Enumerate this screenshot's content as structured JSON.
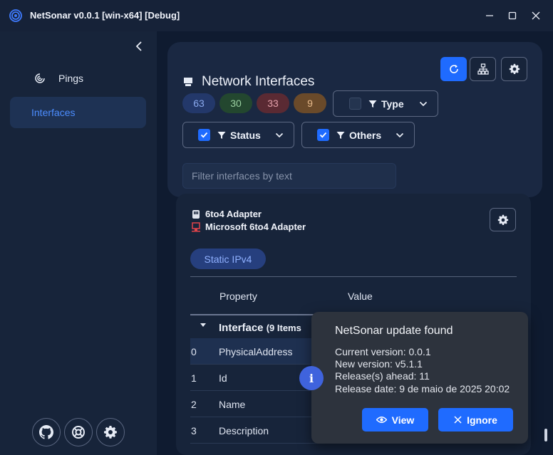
{
  "titlebar": {
    "title": "NetSonar v0.0.1   [win-x64] [Debug]",
    "minimize_icon": "minimize-icon",
    "maximize_icon": "maximize-icon",
    "close_icon": "close-icon"
  },
  "sidebar": {
    "collapse_icon": "chevron-left-icon",
    "items": [
      {
        "label": "Pings",
        "icon": "sonar-icon",
        "active": false
      },
      {
        "label": "Interfaces",
        "active": true
      }
    ],
    "footer_icons": [
      "github-icon",
      "support-icon",
      "gear-icon"
    ]
  },
  "panel": {
    "title": "Network Interfaces",
    "title_icon": "network-adapter-icon",
    "toolbar_icons": [
      "refresh-icon",
      "network-topology-icon",
      "gear-icon"
    ],
    "counts": [
      {
        "value": "63",
        "bg": "#23386a",
        "fg": "#8aa9ee"
      },
      {
        "value": "30",
        "bg": "#23472f",
        "fg": "#9ad0a0"
      },
      {
        "value": "33",
        "bg": "#5a2a33",
        "fg": "#e3a0aa"
      },
      {
        "value": "9",
        "bg": "#6a4a2a",
        "fg": "#e6b98a"
      }
    ],
    "filters": {
      "type": {
        "label": "Type",
        "checked": false
      },
      "status": {
        "label": "Status",
        "checked": true
      },
      "others": {
        "label": "Others",
        "checked": true
      }
    },
    "search": {
      "value": "",
      "placeholder": "Filter interfaces by text"
    }
  },
  "card": {
    "adapter_name": "6to4 Adapter",
    "adapter_description": "Microsoft 6to4 Adapter",
    "chip": "Static IPv4",
    "table": {
      "headers": [
        "Property",
        "Value"
      ],
      "group": {
        "name": "Interface",
        "count": "(9 Items"
      },
      "rows": [
        {
          "index": "0",
          "name": "PhysicalAddress",
          "selected": true
        },
        {
          "index": "1",
          "name": "Id",
          "selected": false
        },
        {
          "index": "2",
          "name": "Name",
          "selected": false
        },
        {
          "index": "3",
          "name": "Description",
          "selected": false
        }
      ]
    }
  },
  "toast": {
    "title": "NetSonar update found",
    "lines": [
      "Current version: 0.0.1",
      "New version: v5.1.1",
      "Release(s) ahead: 11",
      "Release date: 9 de maio de 2025 20:02"
    ],
    "view_label": "View",
    "ignore_label": "Ignore"
  },
  "colors": {
    "accent": "#1f6bff",
    "active_nav_text": "#4c8dff",
    "toast_bg": "#2d333d"
  }
}
